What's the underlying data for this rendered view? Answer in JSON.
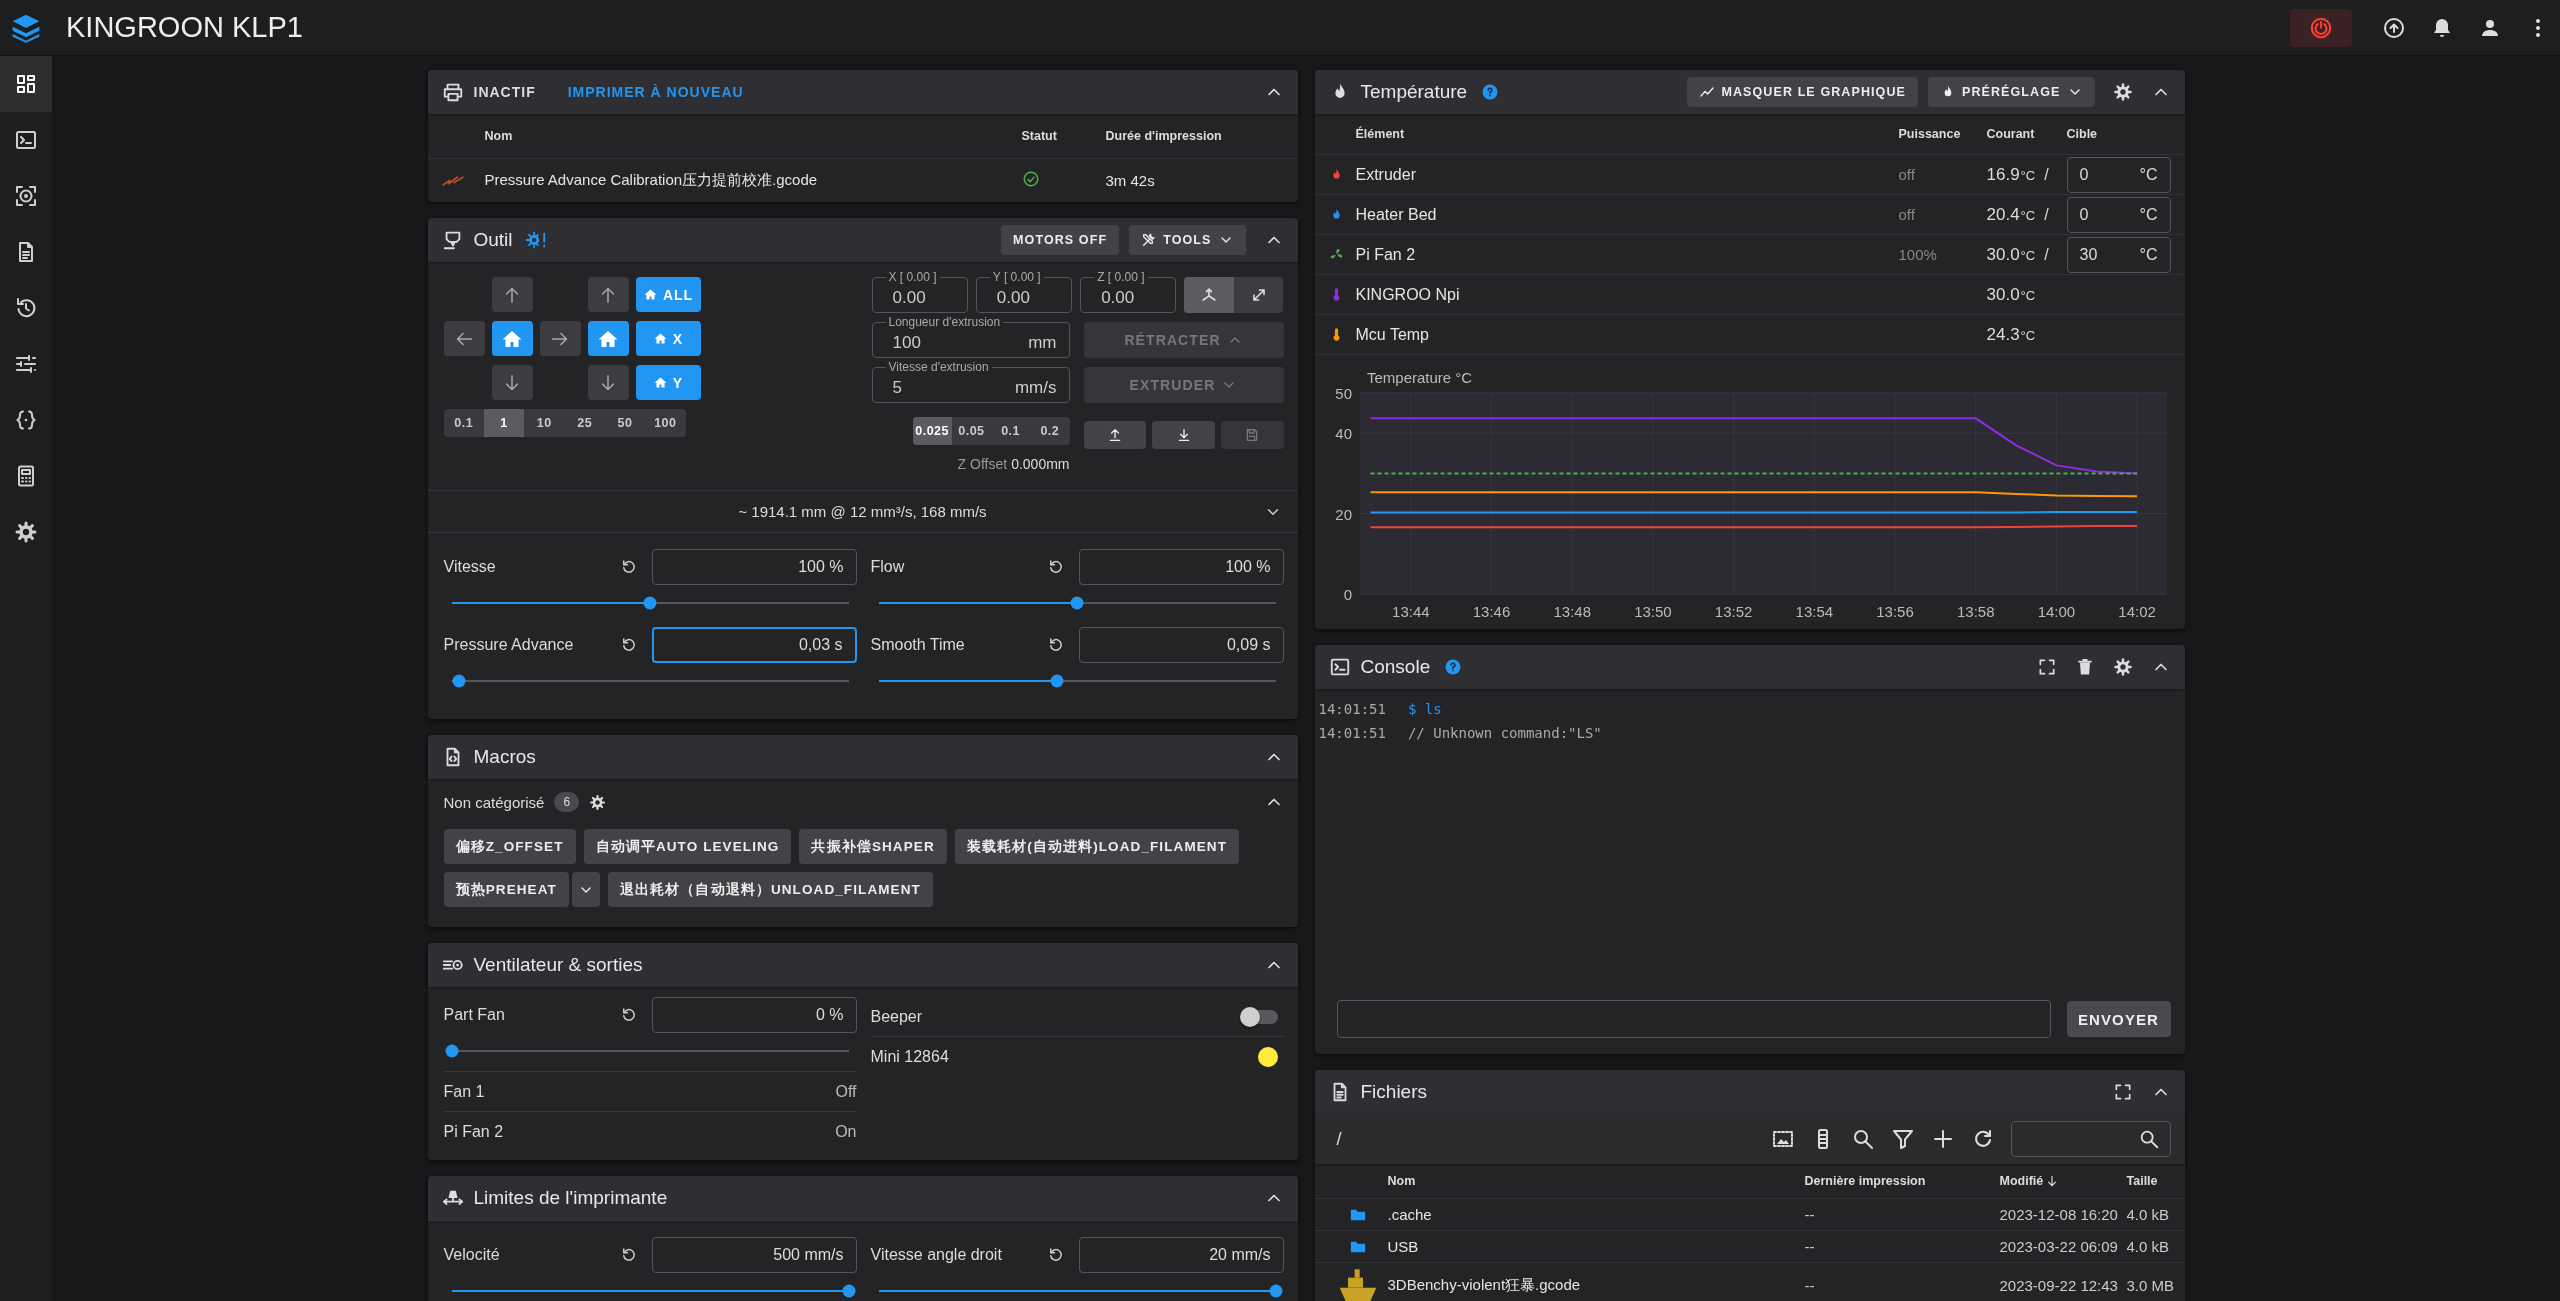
{
  "header": {
    "title": "KINGROON KLP1"
  },
  "sidebar": {
    "items": [
      {
        "selected": true
      },
      {
        "selected": false
      },
      {
        "selected": false
      },
      {
        "selected": false
      },
      {
        "selected": false
      },
      {
        "selected": false
      },
      {
        "selected": false
      },
      {
        "selected": false
      },
      {
        "selected": false
      }
    ]
  },
  "status_panel": {
    "state": "INACTIF",
    "action": "IMPRIMER À NOUVEAU",
    "columns": [
      "Nom",
      "Statut",
      "Durée d'impression"
    ],
    "rows": [
      {
        "name": "Pressure Advance Calibration压力提前校准.gcode",
        "completed": true,
        "duration": "3m 42s"
      }
    ]
  },
  "tool_panel": {
    "title": "Outil",
    "buttons": [
      "MOTORS OFF",
      "TOOLS"
    ],
    "home_buttons": [
      "ALL",
      "X",
      "Y"
    ],
    "step_sizes": [
      {
        "label": "0.1",
        "selected": false
      },
      {
        "label": "1",
        "selected": true
      },
      {
        "label": "10",
        "selected": false
      },
      {
        "label": "25",
        "selected": false
      },
      {
        "label": "50",
        "selected": false
      },
      {
        "label": "100",
        "selected": false
      }
    ],
    "position_fields": [
      {
        "label": "X [ 0.00 ]",
        "value": "0.00"
      },
      {
        "label": "Y [ 0.00 ]",
        "value": "0.00"
      },
      {
        "label": "Z [ 0.00 ]",
        "value": "0.00"
      }
    ],
    "move_modes": [
      {
        "selected": true
      },
      {
        "selected": false
      }
    ],
    "extrusion_fields": [
      {
        "label": "Longueur d'extrusion",
        "value": "100",
        "unit": "mm"
      },
      {
        "label": "Vitesse d'extrusion",
        "value": "5",
        "unit": "mm/s"
      }
    ],
    "extrusion_buttons": [
      {
        "label": "RÉTRACTER",
        "disabled": true
      },
      {
        "label": "EXTRUDER",
        "disabled": true
      }
    ],
    "z_steps": [
      {
        "label": "0.025",
        "selected": true
      },
      {
        "label": "0.05",
        "selected": false
      },
      {
        "label": "0.1",
        "selected": false
      },
      {
        "label": "0.2",
        "selected": false
      }
    ],
    "z_buttons": [
      {
        "disabled": false
      },
      {
        "disabled": false
      },
      {
        "disabled": true
      }
    ],
    "z_offset": {
      "label": "Z Offset",
      "value": "0.000mm"
    },
    "summary": "~ 1914.1 mm @ 12 mm³/s, 168 mm/s",
    "sliders": [
      {
        "label": "Vitesse",
        "value": "100 %",
        "level": 0.5,
        "focused": false
      },
      {
        "label": "Flow",
        "value": "100 %",
        "level": 0.5,
        "focused": false
      },
      {
        "label": "Pressure Advance",
        "value": "0,03 s",
        "level": 0.02,
        "focused": true
      },
      {
        "label": "Smooth Time",
        "value": "0,09 s",
        "level": 0.45,
        "focused": false
      }
    ]
  },
  "macros_panel": {
    "title": "Macros",
    "group": {
      "name": "Non catégorisé",
      "count": "6"
    },
    "buttons": [
      {
        "label": "偏移Z_OFFSET",
        "dropdown": false
      },
      {
        "label": "自动调平AUTO LEVELING",
        "dropdown": false
      },
      {
        "label": "共振补偿SHAPER",
        "dropdown": false
      },
      {
        "label": "装载耗材(自动进料)LOAD_FILAMENT",
        "dropdown": false
      },
      {
        "label": "预热PREHEAT",
        "dropdown": true
      },
      {
        "label": "退出耗材（自动退料）UNLOAD_FILAMENT",
        "dropdown": false
      }
    ]
  },
  "fans_panel": {
    "title": "Ventilateur & sorties",
    "left": [
      {
        "kind": "slider",
        "label": "Part Fan",
        "value": "0 %",
        "level": 0
      },
      {
        "kind": "status",
        "label": "Fan 1",
        "value": "Off"
      },
      {
        "kind": "status",
        "label": "Pi Fan 2",
        "value": "On"
      }
    ],
    "right": [
      {
        "kind": "toggle",
        "label": "Beeper",
        "on": false
      },
      {
        "kind": "led",
        "label": "Mini 12864",
        "color": "#ffeb3b"
      }
    ]
  },
  "limits_panel": {
    "title": "Limites de l'imprimante",
    "sliders": [
      {
        "label": "Velocité",
        "value": "500 mm/s",
        "level": 1
      },
      {
        "label": "Vitesse angle droit",
        "value": "20 mm/s",
        "level": 1
      }
    ]
  },
  "temperature_panel": {
    "title": "Température",
    "buttons": [
      {
        "label": "MASQUER LE GRAPHIQUE",
        "kind": "chart"
      },
      {
        "label": "PRÉRÉGLAGE",
        "kind": "preset"
      }
    ],
    "columns": [
      "Élément",
      "Puissance",
      "Courant",
      "Cible"
    ],
    "rows": [
      {
        "kind": "heater",
        "name": "Extruder",
        "color": "#f44336",
        "power": "off",
        "current": "16.9",
        "unit": "°C",
        "separator": "/",
        "target": {
          "value": "0",
          "unit": "°C"
        }
      },
      {
        "kind": "heater",
        "name": "Heater Bed",
        "color": "#2196f3",
        "power": "off",
        "current": "20.4",
        "unit": "°C",
        "separator": "/",
        "target": {
          "value": "0",
          "unit": "°C"
        }
      },
      {
        "kind": "fan",
        "name": "Pi Fan 2",
        "color": "#4caf50",
        "power": "100%",
        "current": "30.0",
        "unit": "°C",
        "separator": "/",
        "target": {
          "value": "30",
          "unit": "°C"
        }
      },
      {
        "kind": "sensor",
        "name": "KINGROO Npi",
        "color": "#8e2de2",
        "current": "30.0",
        "unit": "°C"
      },
      {
        "kind": "sensor",
        "name": "Mcu Temp",
        "color": "#ff9800",
        "current": "24.3",
        "unit": "°C"
      }
    ],
    "chart_data": {
      "type": "line",
      "ylabel": "Temperature °C",
      "categories": [
        null,
        "13:44",
        null,
        "13:46",
        null,
        "13:48",
        null,
        "13:50",
        null,
        "13:52",
        null,
        "13:54",
        null,
        "13:56",
        null,
        "13:58",
        null,
        "14:00",
        null,
        "14:02"
      ],
      "grid": true,
      "series": [
        {
          "color": "#8e2de2",
          "line_style": "solid",
          "values": [
            43.7,
            43.7,
            43.7,
            43.7,
            43.7,
            43.7,
            43.7,
            43.7,
            43.7,
            43.7,
            43.7,
            43.7,
            43.7,
            43.7,
            43.7,
            43.7,
            37,
            32,
            30.5,
            30
          ]
        },
        {
          "color": "#4caf50",
          "line_style": "dashed",
          "values": [
            30,
            30,
            30,
            30,
            30,
            30,
            30,
            30,
            30,
            30,
            30,
            30,
            30,
            30,
            30,
            30,
            30,
            30,
            30,
            30
          ]
        },
        {
          "color": "#ff9800",
          "line_style": "solid",
          "values": [
            25.3,
            25.3,
            25.3,
            25.3,
            25.3,
            25.3,
            25.3,
            25.3,
            25.3,
            25.3,
            25.3,
            25.3,
            25.3,
            25.3,
            25.3,
            25.3,
            24.9,
            24.5,
            24.4,
            24.3
          ]
        },
        {
          "color": "#2196f3",
          "line_style": "solid",
          "values": [
            20.3,
            20.3,
            20.3,
            20.3,
            20.3,
            20.3,
            20.3,
            20.3,
            20.3,
            20.3,
            20.3,
            20.3,
            20.3,
            20.3,
            20.3,
            20.3,
            20.3,
            20.4,
            20.4,
            20.4
          ]
        },
        {
          "color": "#f44336",
          "line_style": "solid",
          "values": [
            16.6,
            16.6,
            16.6,
            16.6,
            16.6,
            16.6,
            16.6,
            16.6,
            16.6,
            16.6,
            16.6,
            16.6,
            16.6,
            16.6,
            16.6,
            16.6,
            16.7,
            16.8,
            16.9,
            16.9
          ]
        }
      ],
      "ylim": [
        0,
        50
      ],
      "yticks": [
        0,
        20,
        40,
        50
      ]
    }
  },
  "console_panel": {
    "title": "Console",
    "lines": [
      {
        "time": "14:01:51",
        "text": "$ ls",
        "kind": "command"
      },
      {
        "time": "14:01:51",
        "text": "// Unknown command:\"LS\"",
        "kind": "response"
      }
    ],
    "send": "ENVOYER"
  },
  "files_panel": {
    "title": "Fichiers",
    "path": "/",
    "columns": [
      {
        "label": "Nom",
        "sorted": false
      },
      {
        "label": "Dernière impression",
        "sorted": false
      },
      {
        "label": "Modifié",
        "sorted": true
      },
      {
        "label": "Taille",
        "sorted": false
      }
    ],
    "rows": [
      {
        "kind": "folder",
        "name": ".cache",
        "last_print": "--",
        "modified": "2023-12-08 16:20",
        "size": "4.0 kB"
      },
      {
        "kind": "folder",
        "name": "USB",
        "last_print": "--",
        "modified": "2023-03-22 06:09",
        "size": "4.0 kB"
      },
      {
        "kind": "gcode",
        "name": "3DBenchy-violent狂暴.gcode",
        "last_print": "--",
        "modified": "2023-09-22 12:43",
        "size": "3.0 MB"
      }
    ]
  }
}
